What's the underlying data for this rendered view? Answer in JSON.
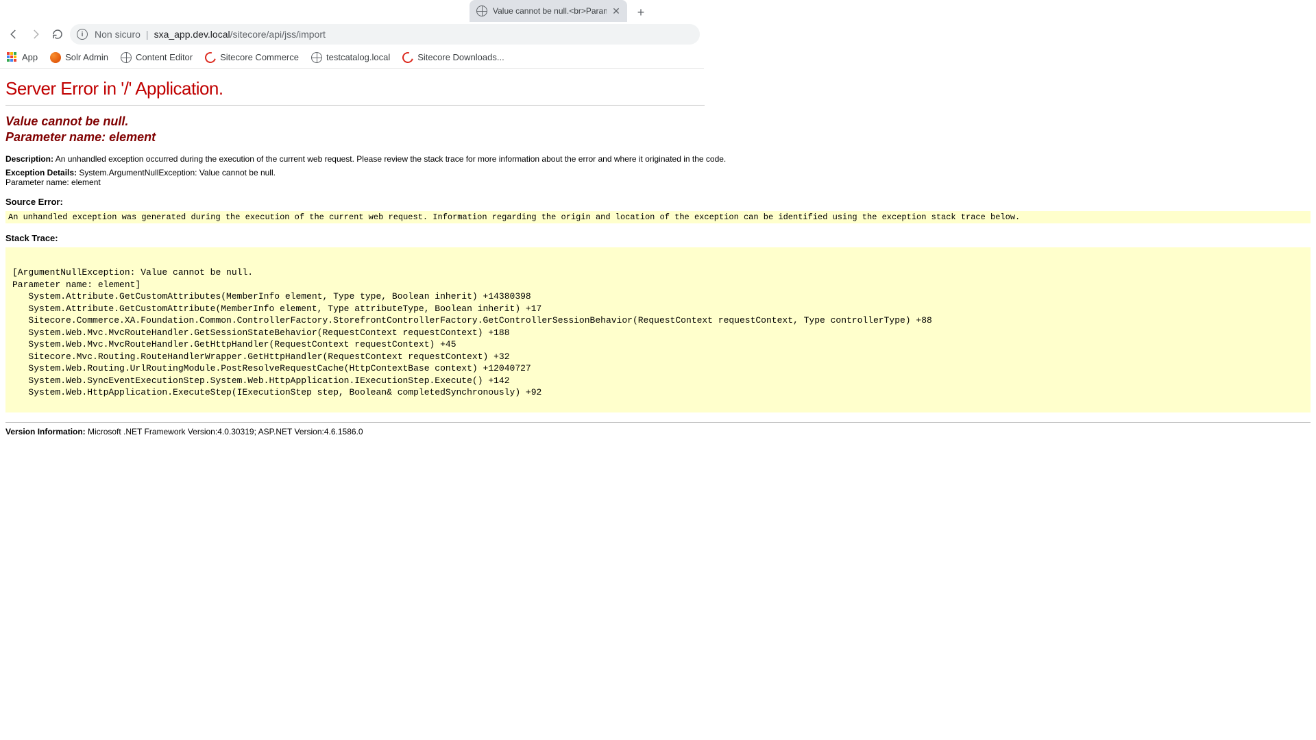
{
  "tab": {
    "title": "Value cannot be null.<br>Parame"
  },
  "nav": {
    "non_secure_label": "Non sicuro",
    "url_host": "sxa_app.dev.local",
    "url_path": "/sitecore/api/jss/import"
  },
  "bookmarks": {
    "apps": "App",
    "solr": "Solr Admin",
    "content_editor": "Content Editor",
    "commerce": "Sitecore Commerce",
    "testcatalog": "testcatalog.local",
    "downloads": "Sitecore Downloads..."
  },
  "error": {
    "title": "Server Error in '/' Application.",
    "message_line1": "Value cannot be null.",
    "message_line2": "Parameter name: element",
    "description_label": "Description:",
    "description_text": "An unhandled exception occurred during the execution of the current web request. Please review the stack trace for more information about the error and where it originated in the code.",
    "exception_label": "Exception Details:",
    "exception_text": "System.ArgumentNullException: Value cannot be null.",
    "exception_param": "Parameter name: element",
    "source_error_label": "Source Error:",
    "source_box": "An unhandled exception was generated during the execution of the current web request. Information regarding the origin and location of the exception can be identified using the exception stack trace below.",
    "stack_trace_label": "Stack Trace:",
    "stack_trace": "[ArgumentNullException: Value cannot be null.\nParameter name: element]\n   System.Attribute.GetCustomAttributes(MemberInfo element, Type type, Boolean inherit) +14380398\n   System.Attribute.GetCustomAttribute(MemberInfo element, Type attributeType, Boolean inherit) +17\n   Sitecore.Commerce.XA.Foundation.Common.ControllerFactory.StorefrontControllerFactory.GetControllerSessionBehavior(RequestContext requestContext, Type controllerType) +88\n   System.Web.Mvc.MvcRouteHandler.GetSessionStateBehavior(RequestContext requestContext) +188\n   System.Web.Mvc.MvcRouteHandler.GetHttpHandler(RequestContext requestContext) +45\n   Sitecore.Mvc.Routing.RouteHandlerWrapper.GetHttpHandler(RequestContext requestContext) +32\n   System.Web.Routing.UrlRoutingModule.PostResolveRequestCache(HttpContextBase context) +12040727\n   System.Web.SyncEventExecutionStep.System.Web.HttpApplication.IExecutionStep.Execute() +142\n   System.Web.HttpApplication.ExecuteStep(IExecutionStep step, Boolean& completedSynchronously) +92",
    "version_label": "Version Information:",
    "version_text": "Microsoft .NET Framework Version:4.0.30319; ASP.NET Version:4.6.1586.0"
  }
}
